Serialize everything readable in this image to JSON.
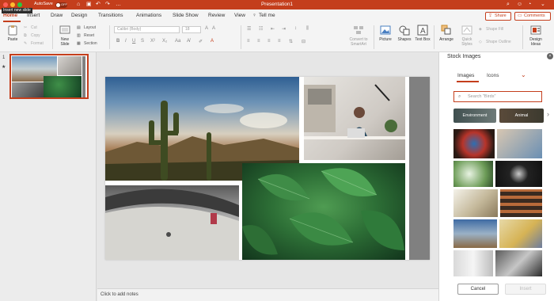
{
  "window": {
    "autosave_label": "AutoSave",
    "autosave_state": "OFF",
    "title": "Presentation1",
    "tooltip": "Insert new slide",
    "traffic_colors": [
      "#ff5f57",
      "#febc2e",
      "#28c840"
    ]
  },
  "tabs": [
    "Home",
    "Insert",
    "Draw",
    "Design",
    "Transitions",
    "Animations",
    "Slide Show",
    "Review",
    "View",
    "Tell me"
  ],
  "active_tab": "Home",
  "header_buttons": {
    "share": "Share",
    "comments": "Comments"
  },
  "ribbon": {
    "paste": "Paste",
    "cut": "Cut",
    "copy": "Copy",
    "format": "Format",
    "new_slide": "New Slide",
    "layout": "Layout",
    "reset": "Reset",
    "section": "Section",
    "font_name": "Calibri (Body)",
    "font_size": "18",
    "convert_smartart": "Convert to SmartArt",
    "picture": "Picture",
    "shapes": "Shapes",
    "text_box": "Text Box",
    "arrange": "Arrange",
    "quick_styles": "Quick Styles",
    "shape_fill": "Shape Fill",
    "shape_outline": "Shape Outline",
    "design_ideas": "Design Ideas"
  },
  "slides_panel": {
    "slide_number": "1",
    "star": "★"
  },
  "notes_placeholder": "Click to add notes",
  "stock_pane": {
    "title": "Stock Images",
    "close_icon": "×",
    "tabs": [
      "Images",
      "Icons"
    ],
    "search_placeholder": "Search \"Birds\"",
    "chips": [
      "Environment",
      "Animal"
    ],
    "cancel": "Cancel",
    "insert": "Insert"
  },
  "colors": {
    "accent": "#c43e1c"
  }
}
